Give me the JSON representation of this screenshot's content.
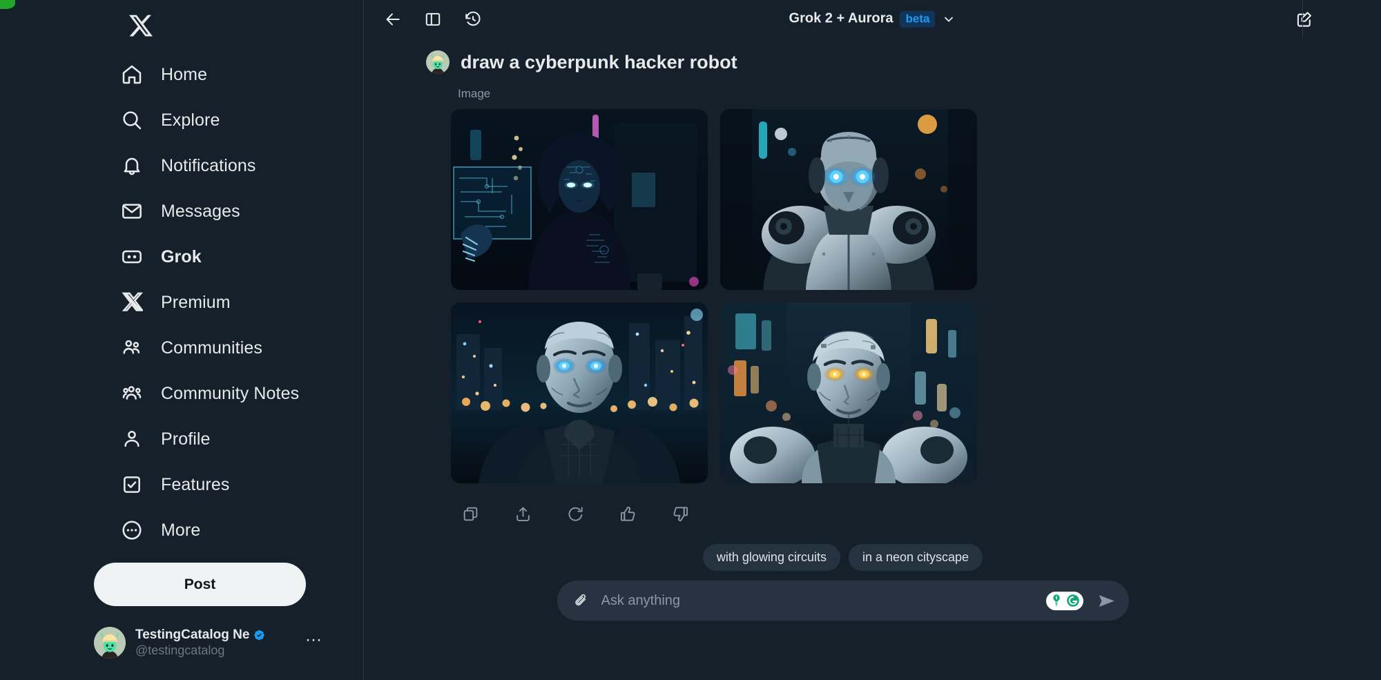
{
  "app": {
    "brand_icon": "x-logo-icon",
    "bg_color": "#15202b",
    "accent_color": "#1d9bf0"
  },
  "sidebar": {
    "items": [
      {
        "label": "Home",
        "icon": "home-icon",
        "active": false
      },
      {
        "label": "Explore",
        "icon": "search-icon",
        "active": false
      },
      {
        "label": "Notifications",
        "icon": "bell-icon",
        "active": false
      },
      {
        "label": "Messages",
        "icon": "envelope-icon",
        "active": false
      },
      {
        "label": "Grok",
        "icon": "grok-icon",
        "active": true
      },
      {
        "label": "Premium",
        "icon": "x-logo-icon",
        "active": false
      },
      {
        "label": "Communities",
        "icon": "communities-icon",
        "active": false
      },
      {
        "label": "Community Notes",
        "icon": "community-notes-icon",
        "active": false
      },
      {
        "label": "Profile",
        "icon": "person-icon",
        "active": false
      },
      {
        "label": "Features",
        "icon": "checkbox-icon",
        "active": false
      },
      {
        "label": "More",
        "icon": "more-circle-icon",
        "active": false
      }
    ],
    "post_button": "Post",
    "account": {
      "display_name": "TestingCatalog Ne",
      "handle": "@testingcatalog",
      "verified": true,
      "verified_color": "#1d9bf0",
      "more_glyph": "···",
      "avatar_icon": "user-avatar"
    }
  },
  "header": {
    "back_icon": "back-arrow-icon",
    "panel_icon": "side-panel-icon",
    "history_icon": "history-clock-icon",
    "model_name": "Grok 2 + Aurora",
    "beta_label": "beta",
    "beta_bg": "#11355a",
    "beta_text_color": "#1d9bf0",
    "chevron_icon": "chevron-down-icon",
    "compose_icon": "compose-new-chat-icon"
  },
  "conversation": {
    "prompt": "draw a cyberpunk hacker robot",
    "prompt_avatar_icon": "user-avatar",
    "section_label": "Image",
    "images": [
      {
        "alt": "hooded cyberpunk hacker with glowing cyan eyes holding a holographic circuit tablet",
        "variant": "hooded-hacker"
      },
      {
        "alt": "armored humanoid robot with bright blue glowing eyes in a dark alley",
        "variant": "armored-robot"
      },
      {
        "alt": "android face with glowing blue eyes against a bokeh night city skyline",
        "variant": "android-skyline"
      },
      {
        "alt": "android with golden glowing eyes on a neon-lit street",
        "variant": "android-neon"
      }
    ],
    "actions": [
      {
        "name": "copy",
        "icon": "copy-icon"
      },
      {
        "name": "share",
        "icon": "share-upload-icon"
      },
      {
        "name": "regenerate",
        "icon": "refresh-icon"
      },
      {
        "name": "like",
        "icon": "thumbs-up-icon"
      },
      {
        "name": "dislike",
        "icon": "thumbs-down-icon"
      }
    ]
  },
  "footer": {
    "suggestions": [
      "with glowing circuits",
      "in a neon cityscape"
    ],
    "composer": {
      "attach_icon": "paperclip-icon",
      "placeholder": "Ask anything",
      "value": "",
      "grammarly_icon": "grammarly-badge-icon",
      "send_icon": "send-arrow-icon"
    }
  }
}
